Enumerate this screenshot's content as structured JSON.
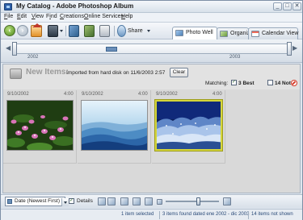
{
  "window": {
    "title": "My Catalog - Adobe Photoshop Album",
    "controls": [
      "_",
      "□",
      "✕"
    ]
  },
  "menu": {
    "items": [
      {
        "pre": "",
        "key": "F",
        "post": "ile"
      },
      {
        "pre": "",
        "key": "E",
        "post": "dit"
      },
      {
        "pre": "",
        "key": "V",
        "post": "iew"
      },
      {
        "pre": "F",
        "key": "i",
        "post": "nd"
      },
      {
        "pre": "",
        "key": "C",
        "post": "reations"
      },
      {
        "pre": "",
        "key": "O",
        "post": "nline Services"
      },
      {
        "pre": "",
        "key": "H",
        "post": "elp"
      }
    ]
  },
  "toolbar": {
    "share_label": "Share",
    "icons": [
      "back-icon",
      "forward-icon",
      "home-icon",
      "camera-import-icon",
      "edit-image-icon",
      "view-image-icon",
      "print-icon",
      "share-icon"
    ]
  },
  "tabs": [
    {
      "label": "Photo Well",
      "active": true
    },
    {
      "label": "Organize",
      "active": false
    },
    {
      "label": "Calendar View",
      "active": false
    }
  ],
  "timeline": {
    "start_label": "2002",
    "end_label": "2003"
  },
  "new_items": {
    "title": "New Items:",
    "description": "Imported from hard disk on 11/6/2003 2:57",
    "clear_label": "Clear",
    "matching_label": "Matching:",
    "best_count": "3",
    "best_label": "Best",
    "best_checked": "✓",
    "not_count": "14",
    "not_label": "Not",
    "not_checked": ""
  },
  "photos": [
    {
      "date": "9/10/2002",
      "time": "4:00",
      "subject": "pink water lilies",
      "selected": false
    },
    {
      "date": "9/10/2002",
      "time": "4:00",
      "subject": "blue mountain ridges",
      "selected": false
    },
    {
      "date": "9/10/2002",
      "time": "4:00",
      "subject": "frosted trees at night",
      "selected": true
    }
  ],
  "bottom_toolbar": {
    "sort_value": "Date (Newest First)",
    "details_label": "Details",
    "details_checked": "✓"
  },
  "status": {
    "selected": "1 item selected",
    "found": "3 items found dated ene 2002 - dic 2003",
    "not_shown": "14 items not shown"
  },
  "colors": {
    "accent": "#2c5fa8",
    "selection": "#d5d53a",
    "not_icon": "#d43b2b"
  }
}
